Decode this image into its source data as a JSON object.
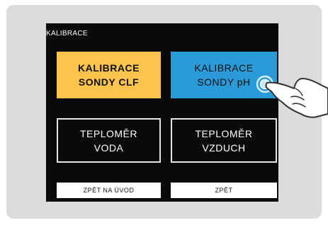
{
  "screen": {
    "title": "KALIBRACE",
    "tiles": {
      "clf": {
        "line1": "KALIBRACE",
        "line2": "SONDY CLF"
      },
      "ph": {
        "line1": "KALIBRACE",
        "line2": "SONDY pH"
      },
      "voda": {
        "line1": "TEPLOMĚR",
        "line2": "VODA"
      },
      "vzduch": {
        "line1": "TEPLOMĚR",
        "line2": "VZDUCH"
      }
    },
    "buttons": {
      "home": "ZPĚT NA ÚVOD",
      "back": "ZPĚT"
    }
  },
  "colors": {
    "clf_tile": "#fcc34d",
    "ph_tile": "#2a9ad8",
    "screen_bg": "#0a0a0a",
    "device_bg": "#dcdcdc"
  },
  "overlay": {
    "icon": "pointing-hand-icon"
  }
}
